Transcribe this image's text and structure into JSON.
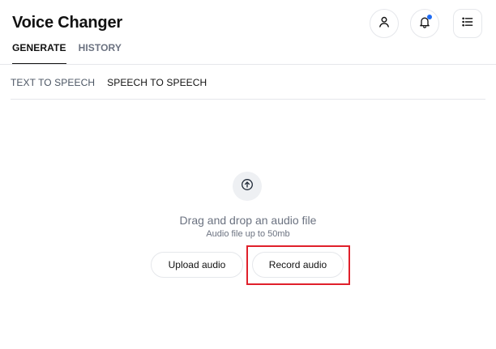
{
  "header": {
    "title": "Voice Changer",
    "icons": [
      "user-icon",
      "bell-icon",
      "list-icon"
    ],
    "notification_dot_color": "#1d6bf3"
  },
  "main_tabs": [
    {
      "label": "GENERATE",
      "active": true
    },
    {
      "label": "HISTORY",
      "active": false
    }
  ],
  "sub_tabs": [
    {
      "label": "TEXT TO SPEECH",
      "active": false
    },
    {
      "label": "SPEECH TO SPEECH",
      "active": true
    }
  ],
  "dropzone": {
    "icon": "upload-arrow-icon",
    "title": "Drag and drop an audio file",
    "subtitle": "Audio file up to 50mb",
    "upload_label": "Upload audio",
    "record_label": "Record audio"
  },
  "highlight_color": "#e0202b"
}
